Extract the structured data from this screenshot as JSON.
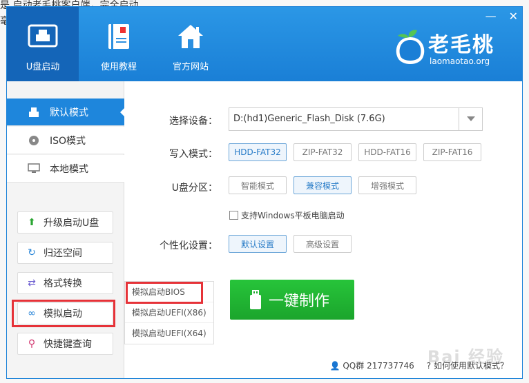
{
  "background_doc": {
    "line1": "是    启动老毛桃客户端，完全启动",
    "line2": "毫"
  },
  "window": {
    "minimize_glyph": "—",
    "close_glyph": "✕"
  },
  "topnav": [
    {
      "label": "U盘启动",
      "icon": "usb-drive-icon",
      "active": true
    },
    {
      "label": "使用教程",
      "icon": "book-icon",
      "active": false
    },
    {
      "label": "官方网站",
      "icon": "home-icon",
      "active": false
    }
  ],
  "logo": {
    "name": "老毛桃",
    "url": "laomaotao.org"
  },
  "modes": [
    {
      "label": "默认模式",
      "icon": "usb-icon",
      "active": true
    },
    {
      "label": "ISO模式",
      "icon": "disc-icon",
      "active": false
    },
    {
      "label": "本地模式",
      "icon": "monitor-icon",
      "active": false
    }
  ],
  "actions": [
    {
      "label": "升级启动U盘",
      "icon": "arrow-up-icon",
      "glyph": "⬆",
      "color": "#2aa532"
    },
    {
      "label": "归还空间",
      "icon": "refresh-icon",
      "glyph": "↻",
      "color": "#2a86d8"
    },
    {
      "label": "格式转换",
      "icon": "swap-icon",
      "glyph": "⇄",
      "color": "#6a5bd0"
    },
    {
      "label": "模拟启动",
      "icon": "link-icon",
      "glyph": "∞",
      "color": "#2a86d8"
    },
    {
      "label": "快捷键查询",
      "icon": "search-icon",
      "glyph": "⚲",
      "color": "#d0306a"
    }
  ],
  "submenu": [
    "模拟启动BIOS",
    "模拟启动UEFI(X86)",
    "模拟启动UEFI(X64)"
  ],
  "form": {
    "device_label": "选择设备：",
    "device_value": "D:(hd1)Generic_Flash_Disk (7.6G)",
    "write_mode_label": "写入模式：",
    "write_modes": [
      "HDD-FAT32",
      "ZIP-FAT32",
      "HDD-FAT16",
      "ZIP-FAT16"
    ],
    "partition_label": "U盘分区：",
    "partitions": [
      "智能模式",
      "兼容模式",
      "增强模式"
    ],
    "tablet_checkbox": "支持Windows平板电脑启动",
    "personal_label": "个性化设置：",
    "personal": [
      "默认设置",
      "高级设置"
    ]
  },
  "make_button": "一键制作",
  "footer": {
    "qq": "QQ群 217737746",
    "help": "如何使用默认模式？"
  },
  "watermark": "Bai 经验"
}
